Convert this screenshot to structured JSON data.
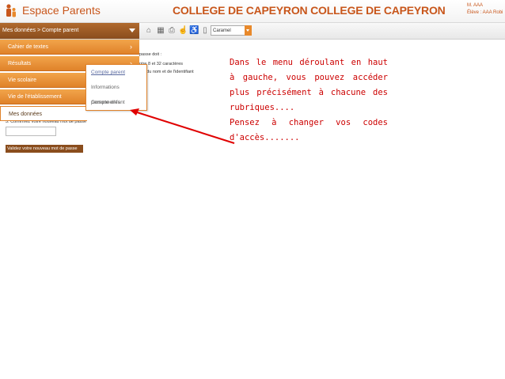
{
  "header": {
    "app_title": "Espace Parents",
    "school_title": "COLLEGE DE CAPEYRON COLLEGE DE CAPEYRON",
    "user_name": "M. AAA",
    "student_label": "Élève : AAA Robi"
  },
  "menubar": {
    "trigger_label": "Mes données > Compte parent",
    "theme_value": "Caramel",
    "icons": [
      "home-icon",
      "save-icon",
      "print-icon",
      "accessibility-icon",
      "wheelchair-icon",
      "help-icon"
    ]
  },
  "dropdown": {
    "items": [
      {
        "label": "Cahier de textes"
      },
      {
        "label": "Résultats"
      },
      {
        "label": "Vie scolaire"
      },
      {
        "label": "Vie de l'établissement"
      },
      {
        "label": "Mes données"
      }
    ],
    "submenu": [
      {
        "label": "Compte parent"
      },
      {
        "label": "Informations personnelles"
      },
      {
        "label": "Compte enfant"
      }
    ]
  },
  "content": {
    "line1": "passe doit :",
    "line2": "ntre 8 et 32 caractères",
    "line3": "ent du nom et de l'identifiant",
    "confirm_label": "3. Confirmez votre nouveau mot de passe",
    "validate_label": "Validez votre nouveau mot de passe"
  },
  "annotation": {
    "paragraph1": "Dans le menu déroulant en haut à gauche, vous pouvez accéder plus précisément à chacune des rubriques....",
    "paragraph2": "Pensez à changer vos codes d'accès......."
  },
  "colors": {
    "accent": "#e0822a",
    "brand_brown": "#8a4d1d",
    "annotation_red": "#cc0000"
  }
}
